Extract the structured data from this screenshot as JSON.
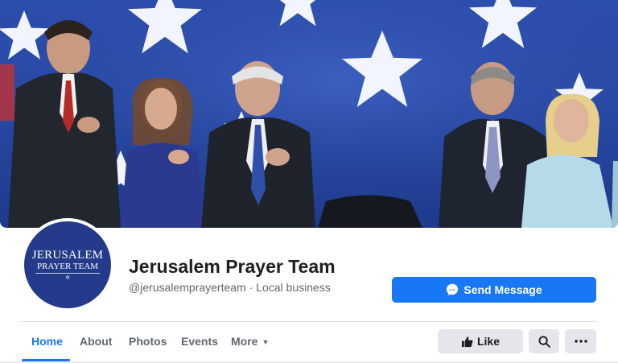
{
  "page": {
    "name": "Jerusalem Prayer Team",
    "handle": "@jerusalemprayerteam",
    "separator": " · ",
    "category": "Local business"
  },
  "avatar": {
    "logo_line1": "JERUSALEM",
    "logo_line2": "PRAYER TEAM",
    "logo_mark": "✡"
  },
  "actions": {
    "send_message_label": "Send Message",
    "send_message_icon": "messenger-icon",
    "like_label": "Like",
    "like_icon": "thumbs-up-icon",
    "search_icon": "search-icon",
    "more_icon": "more-horizontal-icon"
  },
  "tabs": [
    {
      "label": "Home",
      "active": true
    },
    {
      "label": "About",
      "active": false
    },
    {
      "label": "Photos",
      "active": false
    },
    {
      "label": "Events",
      "active": false
    },
    {
      "label": "More",
      "active": false,
      "has_dropdown": true
    }
  ],
  "colors": {
    "accent": "#1877f2",
    "button_gray": "#e4e6eb",
    "avatar_bg": "#243a8a",
    "text_primary": "#1c1e21",
    "text_secondary": "#606770"
  }
}
